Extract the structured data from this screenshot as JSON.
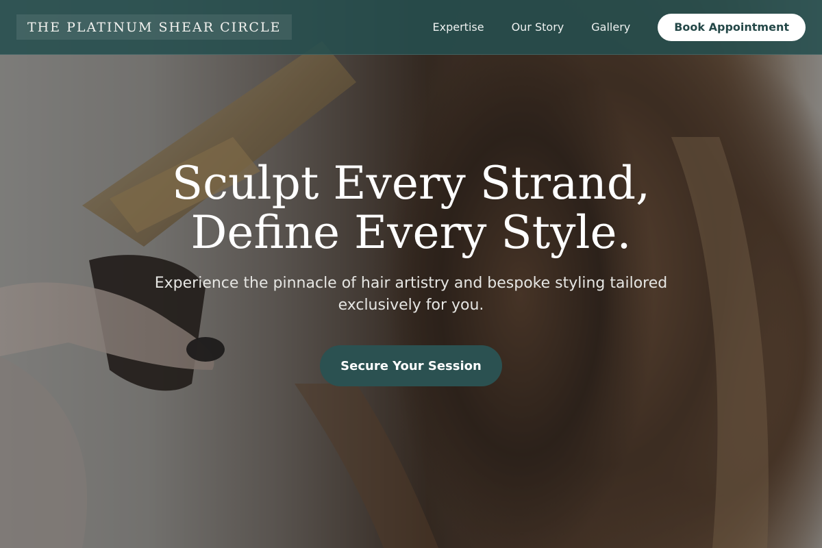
{
  "brand": {
    "name": "THE PLATINUM SHEAR CIRCLE"
  },
  "nav": {
    "links": [
      "Expertise",
      "Our Story",
      "Gallery"
    ],
    "book_label": "Book Appointment"
  },
  "hero": {
    "headline_line1": "Sculpt Every Strand,",
    "headline_line2": "Define Every Style.",
    "subtitle": "Experience the pinnacle of hair artistry and bespoke styling tailored exclusively for you.",
    "cta_label": "Secure Your Session"
  },
  "colors": {
    "nav_bg": "#264e4e",
    "accent": "#2b5151",
    "text_light": "#ffffff"
  }
}
